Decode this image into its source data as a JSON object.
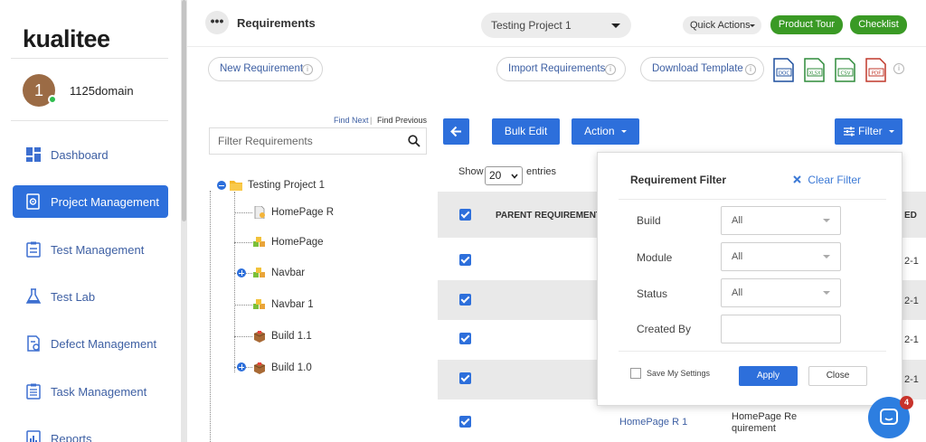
{
  "app": {
    "logo_text": "kualitee"
  },
  "user": {
    "avatar_initial": "1",
    "name": "1125domain"
  },
  "sidebar": {
    "items": [
      {
        "label": "Dashboard",
        "icon": "dashboard-icon"
      },
      {
        "label": "Project Management",
        "icon": "project-gear-icon",
        "active": true
      },
      {
        "label": "Test Management",
        "icon": "test-management-icon"
      },
      {
        "label": "Test Lab",
        "icon": "flask-icon"
      },
      {
        "label": "Defect Management",
        "icon": "defect-icon"
      },
      {
        "label": "Task Management",
        "icon": "clipboard-icon"
      },
      {
        "label": "Reports",
        "icon": "reports-icon"
      }
    ]
  },
  "header": {
    "more_label": "•••",
    "title": "Requirements",
    "project": "Testing Project 1",
    "quick_actions": "Quick Actions",
    "product_tour": "Product Tour",
    "checklist": "Checklist"
  },
  "toolbar": {
    "new_requirement": "New Requirement",
    "import_requirements": "Import Requirements",
    "download_template": "Download Template",
    "info": "i",
    "file_formats": [
      "DOC",
      "XLSX",
      "CSV",
      "PDF"
    ]
  },
  "tree": {
    "find_next": "Find Next",
    "separator": "|",
    "find_previous": "Find Previous",
    "filter_placeholder": "Filter Requirements",
    "root": "Testing Project 1",
    "nodes": [
      "HomePage R",
      "HomePage",
      "Navbar",
      "Navbar 1",
      "Build 1.1",
      "Build 1.0"
    ]
  },
  "grid": {
    "bulk_edit": "Bulk Edit",
    "action": "Action",
    "filter": "Filter",
    "show_label": "Show",
    "page_size": "20",
    "entries_label": "entries",
    "column_parent": "PARENT REQUIREMENT",
    "column_right_fragment": "ED",
    "date_fragment": "2-1",
    "last_row_parent": "HomePage R 1",
    "last_row_name": "HomePage Re quirement"
  },
  "requirement_filter": {
    "title": "Requirement Filter",
    "clear": "Clear Filter",
    "fields": [
      {
        "label": "Build",
        "value": "All"
      },
      {
        "label": "Module",
        "value": "All"
      },
      {
        "label": "Status",
        "value": "All"
      },
      {
        "label": "Created By",
        "value": ""
      }
    ],
    "save_settings": "Save My Settings",
    "apply": "Apply",
    "close": "Close"
  },
  "chat": {
    "badge_count": "4"
  },
  "colors": {
    "primary": "#2d6fdb",
    "green": "#3a9a25",
    "badge": "#c8332b"
  }
}
